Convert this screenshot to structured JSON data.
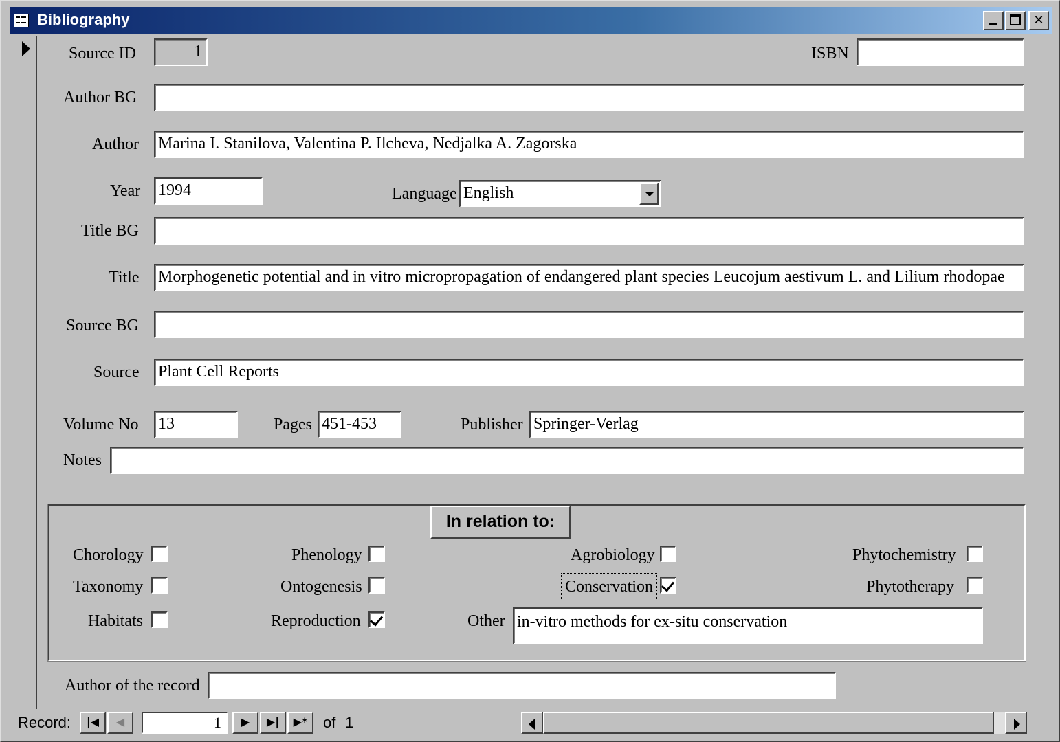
{
  "window": {
    "title": "Bibliography",
    "icon": "form-icon",
    "controls": [
      "minimize",
      "maximize",
      "close"
    ]
  },
  "form": {
    "source_id": {
      "label": "Source ID",
      "value": "1"
    },
    "isbn": {
      "label": "ISBN",
      "value": ""
    },
    "author_bg": {
      "label": "Author BG",
      "value": ""
    },
    "author": {
      "label": "Author",
      "value": "Marina I. Stanilova, Valentina P. Ilcheva, Nedjalka A. Zagorska"
    },
    "year": {
      "label": "Year",
      "value": "1994"
    },
    "language": {
      "label": "Language",
      "value": "English"
    },
    "title_bg": {
      "label": "Title BG",
      "value": ""
    },
    "title": {
      "label": "Title",
      "value": "Morphogenetic potential and in vitro micropropagation of endangered plant species Leucojum aestivum L. and Lilium rhodopae"
    },
    "source_bg": {
      "label": "Source BG",
      "value": ""
    },
    "source": {
      "label": "Source",
      "value": "Plant Cell Reports"
    },
    "volume_no": {
      "label": "Volume No",
      "value": "13"
    },
    "pages": {
      "label": "Pages",
      "value": "451-453"
    },
    "publisher": {
      "label": "Publisher",
      "value": "Springer-Verlag"
    },
    "notes": {
      "label": "Notes",
      "value": ""
    },
    "author_of_record": {
      "label": "Author of the record",
      "value": ""
    }
  },
  "relation": {
    "title": "In relation to:",
    "checkboxes": [
      {
        "label": "Chorology",
        "checked": false
      },
      {
        "label": "Phenology",
        "checked": false
      },
      {
        "label": "Agrobiology",
        "checked": false
      },
      {
        "label": "Phytochemistry",
        "checked": false
      },
      {
        "label": "Taxonomy",
        "checked": false
      },
      {
        "label": "Ontogenesis",
        "checked": false
      },
      {
        "label": "Conservation",
        "checked": true
      },
      {
        "label": "Phytotherapy",
        "checked": false
      },
      {
        "label": "Habitats",
        "checked": false
      },
      {
        "label": "Reproduction",
        "checked": true
      }
    ],
    "other": {
      "label": "Other",
      "value": "in-vitro methods for ex-situ conservation"
    }
  },
  "navigation": {
    "label": "Record:",
    "current": "1",
    "of_label": "of",
    "total": "1"
  }
}
